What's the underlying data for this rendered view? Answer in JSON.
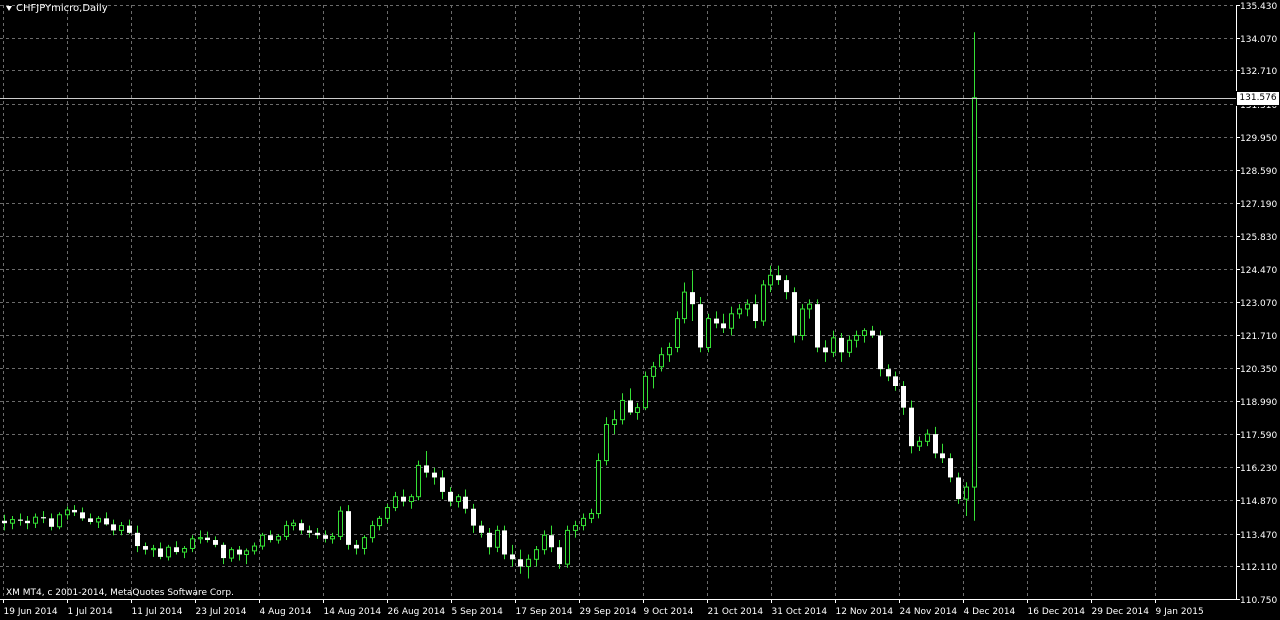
{
  "window": {
    "symbol_title": "CHFJPYmicro,Daily",
    "copyright": "XM MT4, c 2001-2014, MetaQuotes Software Corp."
  },
  "colors": {
    "background": "#000000",
    "grid": "#6b6b6b",
    "candle": "#35e035",
    "text": "#ffffff",
    "current_price_line": "#cccccc"
  },
  "current_price": {
    "label": "131.576",
    "value": 131.576
  },
  "chart_data": {
    "type": "candlestick",
    "title": "CHFJPYmicro,Daily",
    "yaxis_ticks": [
      135.43,
      134.07,
      132.71,
      131.31,
      129.95,
      128.59,
      127.19,
      125.83,
      124.47,
      123.07,
      121.71,
      120.35,
      118.99,
      117.59,
      116.23,
      114.87,
      113.47,
      112.11,
      110.75
    ],
    "yaxis_tick_labels": [
      "135.430",
      "134.070",
      "132.710",
      "131.310",
      "129.950",
      "128.590",
      "127.190",
      "125.830",
      "124.470",
      "123.070",
      "121.710",
      "120.350",
      "118.990",
      "117.590",
      "116.230",
      "114.870",
      "113.470",
      "112.110",
      "110.750"
    ],
    "ylim": [
      110.75,
      135.43
    ],
    "xaxis_tick_labels": [
      "19 Jun 2014",
      "1 Jul 2014",
      "11 Jul 2014",
      "23 Jul 2014",
      "4 Aug 2014",
      "14 Aug 2014",
      "26 Aug 2014",
      "5 Sep 2014",
      "17 Sep 2014",
      "29 Sep 2014",
      "9 Oct 2014",
      "21 Oct 2014",
      "31 Oct 2014",
      "12 Nov 2014",
      "24 Nov 2014",
      "4 Dec 2014",
      "16 Dec 2014",
      "29 Dec 2014",
      "9 Jan 2015"
    ],
    "grid": true,
    "candles": {
      "columns": [
        "open",
        "high",
        "low",
        "close"
      ],
      "rows": [
        [
          114.0,
          114.25,
          113.6,
          113.9
        ],
        [
          113.9,
          114.2,
          113.65,
          114.05
        ],
        [
          114.05,
          114.3,
          113.8,
          114.0
        ],
        [
          114.0,
          114.2,
          113.65,
          113.9
        ],
        [
          113.9,
          114.3,
          113.7,
          114.15
        ],
        [
          114.15,
          114.4,
          113.9,
          114.1
        ],
        [
          114.1,
          114.3,
          113.6,
          113.75
        ],
        [
          113.75,
          114.35,
          113.65,
          114.25
        ],
        [
          114.25,
          114.6,
          114.05,
          114.45
        ],
        [
          114.45,
          114.65,
          114.2,
          114.35
        ],
        [
          114.35,
          114.55,
          114.0,
          114.1
        ],
        [
          114.1,
          114.3,
          113.85,
          113.95
        ],
        [
          113.95,
          114.2,
          113.7,
          114.1
        ],
        [
          114.1,
          114.35,
          113.8,
          113.85
        ],
        [
          113.85,
          114.05,
          113.4,
          113.6
        ],
        [
          113.6,
          113.95,
          113.4,
          113.8
        ],
        [
          113.8,
          114.05,
          113.45,
          113.5
        ],
        [
          113.5,
          113.8,
          112.7,
          112.95
        ],
        [
          112.95,
          113.1,
          112.6,
          112.8
        ],
        [
          112.8,
          113.0,
          112.5,
          112.85
        ],
        [
          112.85,
          113.1,
          112.4,
          112.5
        ],
        [
          112.5,
          113.0,
          112.35,
          112.9
        ],
        [
          112.9,
          113.15,
          112.6,
          112.7
        ],
        [
          112.7,
          112.95,
          112.45,
          112.85
        ],
        [
          112.85,
          113.4,
          112.7,
          113.25
        ],
        [
          113.25,
          113.6,
          113.05,
          113.3
        ],
        [
          113.3,
          113.55,
          113.1,
          113.2
        ],
        [
          113.2,
          113.35,
          112.9,
          113.0
        ],
        [
          113.0,
          113.1,
          112.2,
          112.45
        ],
        [
          112.45,
          112.9,
          112.3,
          112.8
        ],
        [
          112.8,
          112.95,
          112.35,
          112.6
        ],
        [
          112.6,
          112.85,
          112.2,
          112.75
        ],
        [
          112.75,
          113.1,
          112.6,
          112.95
        ],
        [
          112.95,
          113.5,
          112.8,
          113.4
        ],
        [
          113.4,
          113.6,
          113.1,
          113.2
        ],
        [
          113.2,
          113.45,
          113.05,
          113.35
        ],
        [
          113.35,
          114.0,
          113.2,
          113.8
        ],
        [
          113.8,
          114.05,
          113.6,
          113.9
        ],
        [
          113.9,
          114.05,
          113.45,
          113.6
        ],
        [
          113.6,
          113.8,
          113.3,
          113.5
        ],
        [
          113.5,
          113.7,
          113.25,
          113.4
        ],
        [
          113.4,
          113.6,
          113.1,
          113.25
        ],
        [
          113.25,
          113.5,
          113.05,
          113.35
        ],
        [
          113.35,
          114.6,
          113.2,
          114.4
        ],
        [
          114.4,
          114.65,
          112.8,
          113.0
        ],
        [
          113.0,
          113.2,
          112.6,
          112.85
        ],
        [
          112.85,
          113.4,
          112.6,
          113.3
        ],
        [
          113.3,
          114.0,
          113.1,
          113.8
        ],
        [
          113.8,
          114.2,
          113.6,
          114.1
        ],
        [
          114.1,
          114.7,
          113.9,
          114.55
        ],
        [
          114.55,
          115.2,
          114.4,
          115.0
        ],
        [
          115.0,
          115.3,
          114.6,
          114.8
        ],
        [
          114.8,
          115.1,
          114.5,
          115.0
        ],
        [
          115.0,
          116.5,
          114.85,
          116.3
        ],
        [
          116.3,
          116.9,
          115.8,
          116.0
        ],
        [
          116.0,
          116.2,
          115.5,
          115.8
        ],
        [
          115.8,
          116.1,
          114.9,
          115.2
        ],
        [
          115.2,
          115.4,
          114.6,
          114.8
        ],
        [
          114.8,
          115.1,
          114.55,
          115.0
        ],
        [
          115.0,
          115.3,
          114.3,
          114.5
        ],
        [
          114.5,
          114.7,
          113.5,
          113.8
        ],
        [
          113.8,
          114.0,
          113.3,
          113.5
        ],
        [
          113.5,
          113.7,
          112.6,
          112.9
        ],
        [
          112.9,
          113.8,
          112.7,
          113.6
        ],
        [
          113.6,
          113.8,
          112.4,
          112.6
        ],
        [
          112.6,
          113.0,
          112.1,
          112.4
        ],
        [
          112.4,
          112.8,
          111.8,
          112.1
        ],
        [
          112.1,
          112.6,
          111.6,
          112.4
        ],
        [
          112.4,
          112.95,
          112.1,
          112.8
        ],
        [
          112.8,
          113.6,
          112.6,
          113.4
        ],
        [
          113.4,
          113.8,
          112.7,
          112.9
        ],
        [
          112.9,
          113.2,
          112.0,
          112.2
        ],
        [
          112.2,
          113.8,
          112.05,
          113.6
        ],
        [
          113.6,
          114.0,
          113.3,
          113.8
        ],
        [
          113.8,
          114.3,
          113.6,
          114.1
        ],
        [
          114.1,
          114.5,
          113.9,
          114.3
        ],
        [
          114.3,
          116.8,
          114.1,
          116.5
        ],
        [
          116.5,
          118.3,
          116.3,
          118.0
        ],
        [
          118.0,
          118.6,
          117.6,
          118.2
        ],
        [
          118.2,
          119.3,
          118.0,
          119.0
        ],
        [
          119.0,
          119.5,
          118.4,
          118.5
        ],
        [
          118.5,
          118.9,
          118.2,
          118.7
        ],
        [
          118.7,
          120.2,
          118.6,
          120.0
        ],
        [
          120.0,
          120.6,
          119.5,
          120.4
        ],
        [
          120.4,
          121.2,
          120.2,
          120.9
        ],
        [
          120.9,
          121.4,
          120.6,
          121.2
        ],
        [
          121.2,
          122.7,
          121.0,
          122.4
        ],
        [
          122.4,
          123.9,
          122.2,
          123.5
        ],
        [
          123.5,
          124.4,
          122.3,
          123.0
        ],
        [
          123.0,
          123.3,
          121.0,
          121.2
        ],
        [
          121.2,
          122.6,
          121.0,
          122.4
        ],
        [
          122.4,
          122.7,
          122.0,
          122.2
        ],
        [
          122.2,
          122.6,
          121.8,
          122.0
        ],
        [
          122.0,
          122.9,
          121.7,
          122.6
        ],
        [
          122.6,
          123.0,
          122.4,
          122.8
        ],
        [
          122.8,
          123.2,
          122.5,
          123.0
        ],
        [
          123.0,
          123.4,
          122.0,
          122.3
        ],
        [
          122.3,
          124.0,
          122.1,
          123.8
        ],
        [
          123.8,
          124.6,
          123.5,
          124.2
        ],
        [
          124.2,
          124.6,
          123.8,
          124.0
        ],
        [
          124.0,
          124.2,
          123.2,
          123.5
        ],
        [
          123.5,
          123.7,
          121.4,
          121.7
        ],
        [
          121.7,
          123.0,
          121.5,
          122.8
        ],
        [
          122.8,
          123.2,
          122.4,
          123.0
        ],
        [
          123.0,
          123.2,
          121.0,
          121.2
        ],
        [
          121.2,
          121.5,
          120.6,
          121.0
        ],
        [
          121.0,
          121.9,
          120.8,
          121.6
        ],
        [
          121.6,
          121.8,
          120.6,
          121.0
        ],
        [
          121.0,
          121.7,
          120.8,
          121.5
        ],
        [
          121.5,
          121.9,
          121.2,
          121.7
        ],
        [
          121.7,
          122.0,
          121.4,
          121.9
        ],
        [
          121.9,
          122.1,
          121.6,
          121.7
        ],
        [
          121.7,
          121.9,
          120.0,
          120.3
        ],
        [
          120.3,
          120.5,
          119.8,
          120.0
        ],
        [
          120.0,
          120.2,
          119.4,
          119.6
        ],
        [
          119.6,
          119.8,
          118.4,
          118.7
        ],
        [
          118.7,
          119.0,
          116.8,
          117.1
        ],
        [
          117.1,
          117.5,
          116.9,
          117.3
        ],
        [
          117.3,
          117.8,
          117.1,
          117.6
        ],
        [
          117.6,
          117.9,
          116.6,
          116.8
        ],
        [
          116.8,
          117.2,
          116.4,
          116.6
        ],
        [
          116.6,
          116.8,
          115.6,
          115.8
        ],
        [
          115.8,
          116.0,
          114.7,
          114.9
        ],
        [
          114.9,
          115.6,
          114.2,
          115.4
        ],
        [
          115.4,
          134.3,
          114.0,
          131.576
        ]
      ]
    }
  }
}
